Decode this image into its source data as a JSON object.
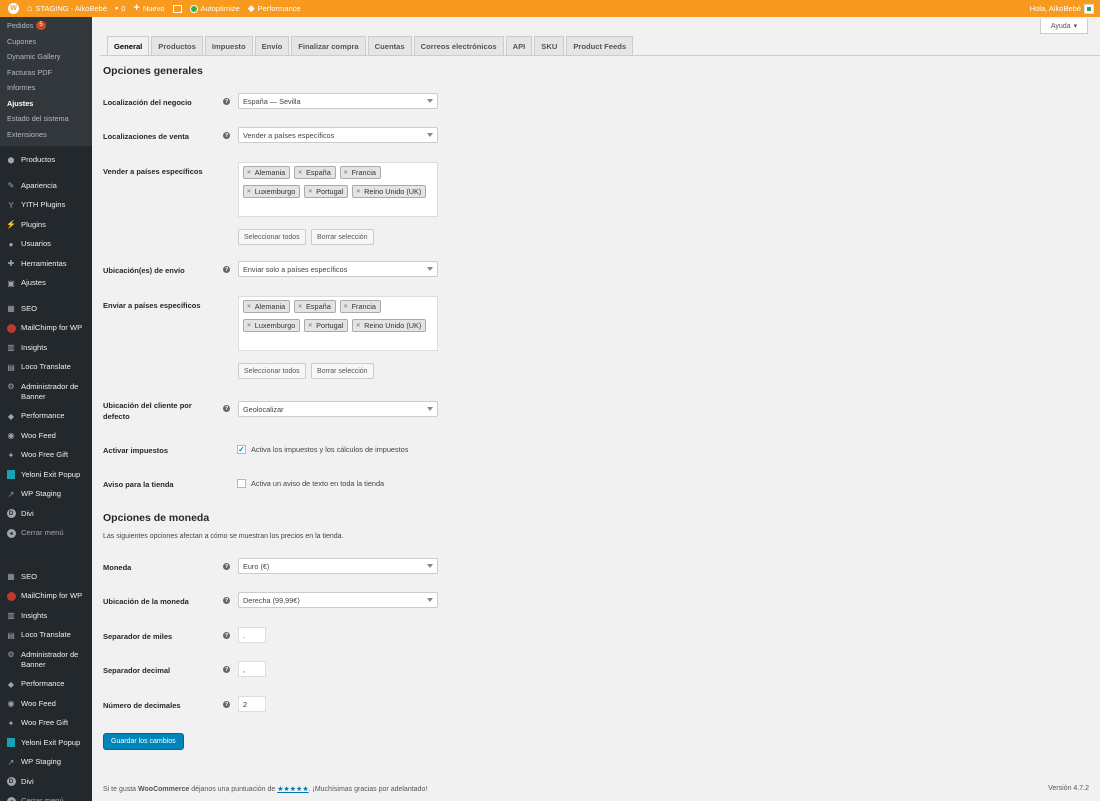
{
  "adminbar": {
    "site_name": "STAGING - AikoBebé",
    "comments_count": "0",
    "new_label": "Nuevo",
    "autoptimize": "Autoptimize",
    "performance": "Performance",
    "greeting": "Hola, AikoBebé"
  },
  "sidebar": {
    "submenu": [
      {
        "label": "Pedidos",
        "badge": "5"
      },
      {
        "label": "Cupones"
      },
      {
        "label": "Dynamic Gallery"
      },
      {
        "label": "Facturas PDF"
      },
      {
        "label": "Informes"
      },
      {
        "label": "Ajustes",
        "current": true
      },
      {
        "label": "Estado del sistema"
      },
      {
        "label": "Extensiones"
      }
    ],
    "menu_a": [
      {
        "label": "Productos",
        "icon": "products-icon"
      },
      {
        "label": "Apariencia",
        "icon": "appearance-icon"
      },
      {
        "label": "YITH Plugins",
        "icon": "yith-icon"
      },
      {
        "label": "Plugins",
        "icon": "plugins-icon"
      },
      {
        "label": "Usuarios",
        "icon": "users-icon"
      },
      {
        "label": "Herramientas",
        "icon": "tools-icon"
      },
      {
        "label": "Ajustes",
        "icon": "settings-icon"
      }
    ],
    "menu_b": [
      {
        "label": "SEO",
        "icon": "seo-icon"
      },
      {
        "label": "MailChimp for WP",
        "icon": "mailchimp-icon"
      },
      {
        "label": "Insights",
        "icon": "insights-icon"
      },
      {
        "label": "Loco Translate",
        "icon": "loco-icon"
      },
      {
        "label": "Administrador de Banner",
        "icon": "gear-icon"
      },
      {
        "label": "Performance",
        "icon": "performance-icon"
      },
      {
        "label": "Woo Feed",
        "icon": "feed-icon"
      },
      {
        "label": "Woo Free Gift",
        "icon": "gift-icon"
      },
      {
        "label": "Yeloni Exit Popup",
        "icon": "popup-icon"
      },
      {
        "label": "WP Staging",
        "icon": "staging-icon"
      },
      {
        "label": "Divi",
        "icon": "divi-icon"
      }
    ],
    "collapse_label": "Cerrar menú"
  },
  "help": {
    "label": "Ayuda"
  },
  "tabs": [
    {
      "label": "General",
      "active": true
    },
    {
      "label": "Productos"
    },
    {
      "label": "Impuesto"
    },
    {
      "label": "Envío"
    },
    {
      "label": "Finalizar compra"
    },
    {
      "label": "Cuentas"
    },
    {
      "label": "Correos electrónicos"
    },
    {
      "label": "API"
    },
    {
      "label": "SKU"
    },
    {
      "label": "Product Feeds"
    }
  ],
  "general": {
    "heading": "Opciones generales",
    "store_location": {
      "label": "Localización del negocio",
      "value": "España — Sevilla"
    },
    "selling_locations": {
      "label": "Localizaciones de venta",
      "value": "Vender a países específicos"
    },
    "specific_sell": {
      "label": "Vender a países específicos",
      "countries": [
        "Alemania",
        "España",
        "Francia",
        "Luxemburgo",
        "Portugal",
        "Reino Unido (UK)"
      ]
    },
    "select_all": "Seleccionar todos",
    "clear_selection": "Borrar selección",
    "shipping_locations": {
      "label": "Ubicación(es) de envío",
      "value": "Enviar solo a países específicos"
    },
    "specific_ship": {
      "label": "Enviar a países específicos",
      "countries": [
        "Alemania",
        "España",
        "Francia",
        "Luxemburgo",
        "Portugal",
        "Reino Unido (UK)"
      ]
    },
    "default_customer": {
      "label": "Ubicación del cliente por defecto",
      "value": "Geolocalizar"
    },
    "enable_taxes": {
      "label": "Activar impuestos",
      "text": "Activa los impuestos y los cálculos de impuestos",
      "checked": true
    },
    "store_notice": {
      "label": "Aviso para la tienda",
      "text": "Activa un aviso de texto en toda la tienda",
      "checked": false
    }
  },
  "currency": {
    "heading": "Opciones de moneda",
    "description": "Las siguientes opciones afectan a cómo se muestran los precios en la tienda.",
    "currency": {
      "label": "Moneda",
      "value": "Euro (€)"
    },
    "position": {
      "label": "Ubicación de la moneda",
      "value": "Derecha (99,99€)"
    },
    "thousand_sep": {
      "label": "Separador de miles",
      "value": "."
    },
    "decimal_sep": {
      "label": "Separador decimal",
      "value": ","
    },
    "num_decimals": {
      "label": "Número de decimales",
      "value": "2"
    }
  },
  "save_button": "Guardar los cambios",
  "footer": {
    "text_before": "Si te gusta ",
    "brand": "WooCommerce",
    "text_mid": " déjanos una puntuación de ",
    "stars": "★★★★★",
    "text_after": ". ¡Muchísimas gracias por adelantado!",
    "version": "Versión 4.7.2"
  }
}
